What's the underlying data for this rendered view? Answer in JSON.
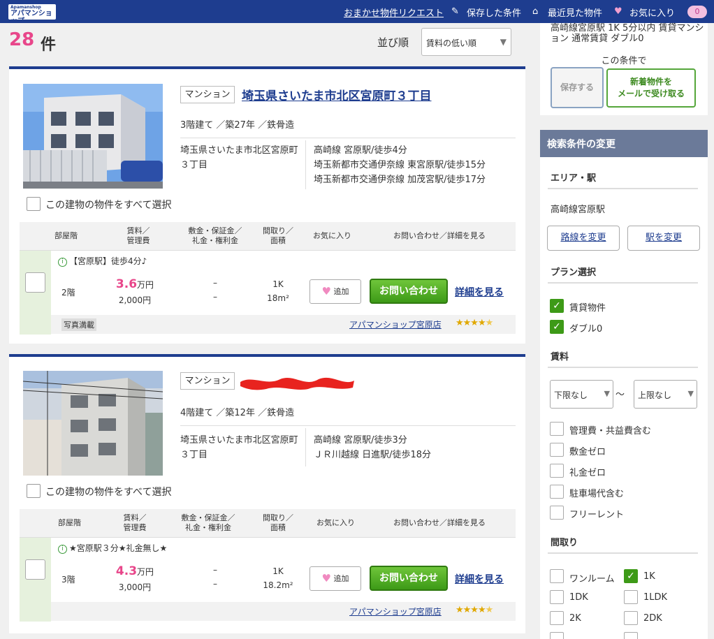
{
  "header": {
    "logo_text": "アパマンショップ",
    "logo_sub": "Apamanshop",
    "nav": {
      "request": "おまかせ物件リクエスト",
      "saved": "保存した条件",
      "recent": "最近見た物件",
      "favorites": "お気に入り",
      "fav_count": "0"
    },
    "icons": [
      "pencil-icon",
      "home-icon",
      "heart-icon"
    ]
  },
  "results": {
    "count": "28",
    "count_unit": "件",
    "sort_label": "並び順",
    "sort_value": "賃料の低い順"
  },
  "table_headers": [
    "部屋階",
    "賃料／\n管理費",
    "敷金・保証金／\n礼金・権利金",
    "間取り／\n面積",
    "お気に入り",
    "お問い合わせ／詳細を見る"
  ],
  "listings": [
    {
      "type": "マンション",
      "name": "埼玉県さいたま市北区宮原町３丁目",
      "meta": "3階建て ／築27年 ／鉄骨造",
      "address": "埼玉県さいたま市北区宮原町３丁目",
      "access": [
        "高崎線 宮原駅/徒歩4分",
        "埼玉新都市交通伊奈線 東宮原駅/徒歩15分",
        "埼玉新都市交通伊奈線 加茂宮駅/徒歩17分"
      ],
      "select_all": "この建物の物件をすべて選択",
      "room": {
        "note": "【宮原駅】徒歩4分♪",
        "floor": "2階",
        "rent": "3.6",
        "rent_unit": "万円",
        "mgmt_fee": "2,000円",
        "deposit": "–",
        "key_money": "–",
        "layout": "1K",
        "area": "18m²",
        "fav_label": "追加",
        "inquiry_label": "お問い合わせ",
        "detail_label": "詳細を見る",
        "photo_tag": "写真満載",
        "shop": "アパマンショップ宮原店",
        "rating": 4.5
      }
    },
    {
      "type": "マンション",
      "name": "",
      "meta": "4階建て ／築12年 ／鉄骨造",
      "address": "埼玉県さいたま市北区宮原町３丁目",
      "access": [
        "高崎線 宮原駅/徒歩3分",
        "ＪＲ川越線 日進駅/徒歩18分"
      ],
      "select_all": "この建物の物件をすべて選択",
      "room": {
        "note": "★宮原駅３分★礼金無し★",
        "floor": "3階",
        "rent": "4.3",
        "rent_unit": "万円",
        "mgmt_fee": "3,000円",
        "deposit": "–",
        "key_money": "–",
        "layout": "1K",
        "area": "18.2m²",
        "fav_label": "追加",
        "inquiry_label": "お問い合わせ",
        "detail_label": "詳細を見る",
        "photo_tag": "",
        "shop": "アパマンショップ宮原店",
        "rating": 4.5
      }
    }
  ],
  "sidebar": {
    "condition_text": "高崎線宮原駅 1K 5分以内 賃貸マンション 通常賃貸 ダブル0",
    "condition_caption": "この条件で",
    "save_btn": "保存する",
    "mail_btn_line1": "新着物件を",
    "mail_btn_line2": "メールで受け取る",
    "search_title": "検索条件の変更",
    "area_title": "エリア・駅",
    "area_value": "高崎線宮原駅",
    "change_route": "路線を変更",
    "change_station": "駅を変更",
    "plan_title": "プラン選択",
    "plans": [
      {
        "label": "賃貸物件",
        "checked": true
      },
      {
        "label": "ダブル0",
        "checked": true
      }
    ],
    "rent_title": "賃料",
    "rent_min": "下限なし",
    "rent_max": "上限なし",
    "rent_tilde": "～",
    "rent_options": [
      {
        "label": "管理費・共益費含む",
        "checked": false
      },
      {
        "label": "敷金ゼロ",
        "checked": false
      },
      {
        "label": "礼金ゼロ",
        "checked": false
      },
      {
        "label": "駐車場代含む",
        "checked": false
      },
      {
        "label": "フリーレント",
        "checked": false
      }
    ],
    "layout_title": "間取り",
    "layouts": [
      {
        "label": "ワンルーム",
        "checked": false
      },
      {
        "label": "1K",
        "checked": true
      },
      {
        "label": "1DK",
        "checked": false
      },
      {
        "label": "1LDK",
        "checked": false
      },
      {
        "label": "2K",
        "checked": false
      },
      {
        "label": "2DK",
        "checked": false
      }
    ]
  },
  "colors": {
    "brand": "#1e3d8f",
    "accent_pink": "#e8468a",
    "green": "#3d9a17"
  }
}
